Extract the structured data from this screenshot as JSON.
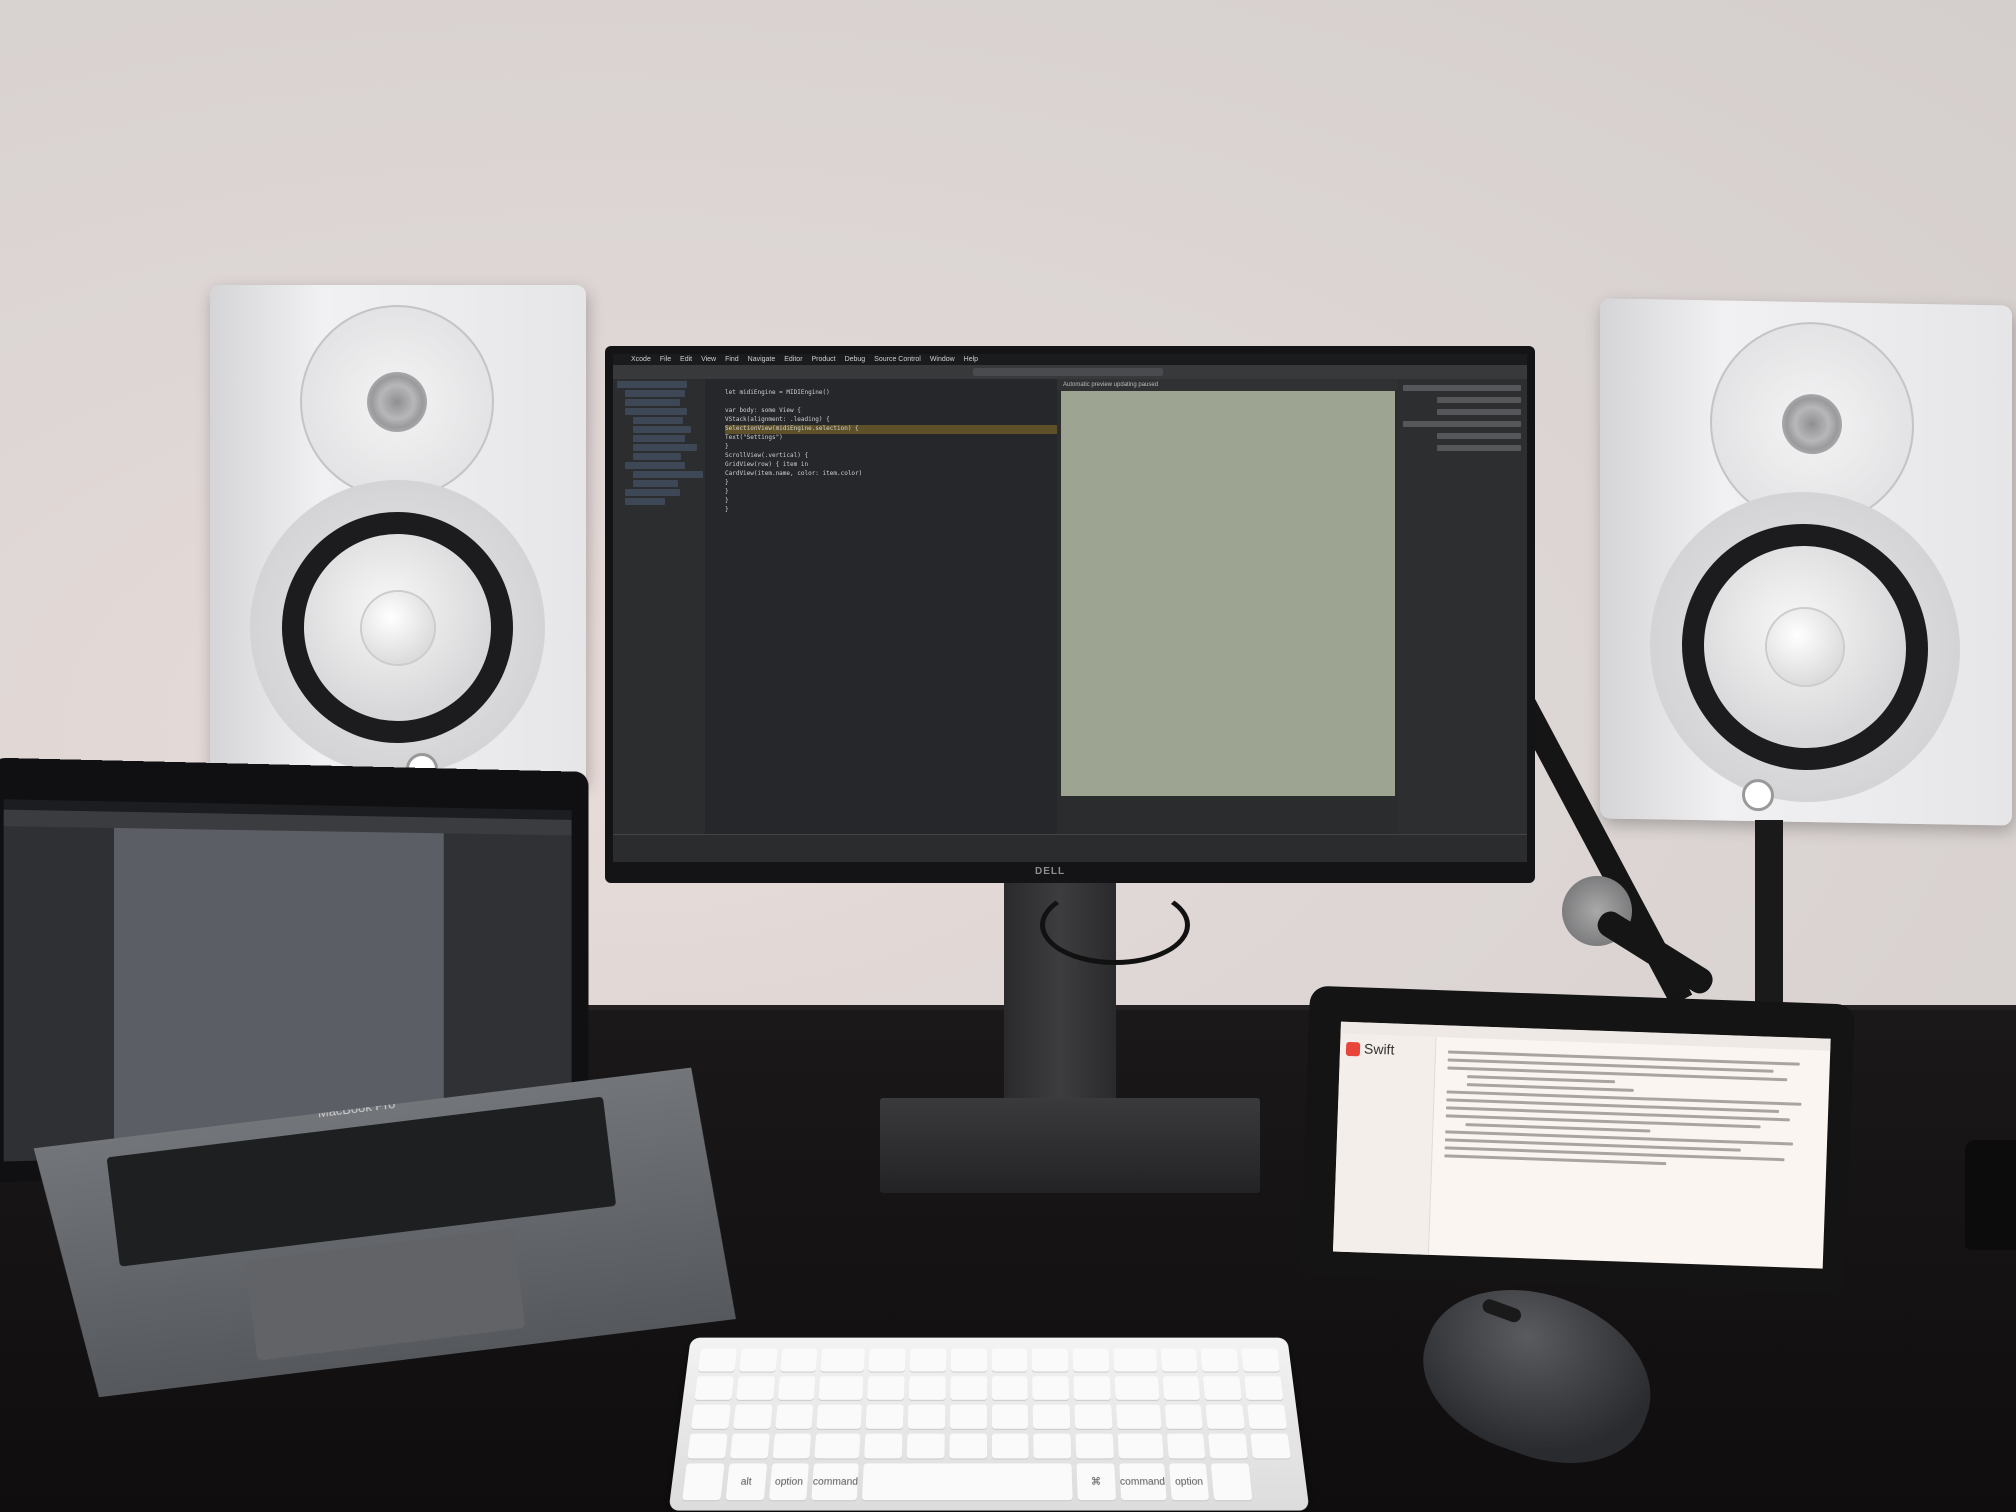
{
  "monitor": {
    "brand_text": "DELL",
    "menubar_items": [
      "Xcode",
      "File",
      "Edit",
      "View",
      "Find",
      "Navigate",
      "Editor",
      "Product",
      "Debug",
      "Source Control",
      "Window",
      "Help"
    ],
    "preview_header": "Automatic preview updating paused",
    "code_lines": [
      "let midiEngine = MIDIEngine()",
      "",
      "var body: some View {",
      "  VStack(alignment: .leading) {",
      "    SelectionView(midiEngine.selection) {",
      "      Text(\"Settings\")",
      "    }",
      "    ScrollView(.vertical) {",
      "      GridView(row) { item in",
      "        CardView(item.name, color: item.color)",
      "      }",
      "    }",
      "  }",
      "}"
    ]
  },
  "laptop": {
    "label": "MacBook Pro"
  },
  "ipad": {
    "app_title": "Swift"
  },
  "magic_keyboard": {
    "bottom_row_labels": [
      "alt",
      "option",
      "command",
      "⌘",
      "command",
      "option"
    ]
  }
}
